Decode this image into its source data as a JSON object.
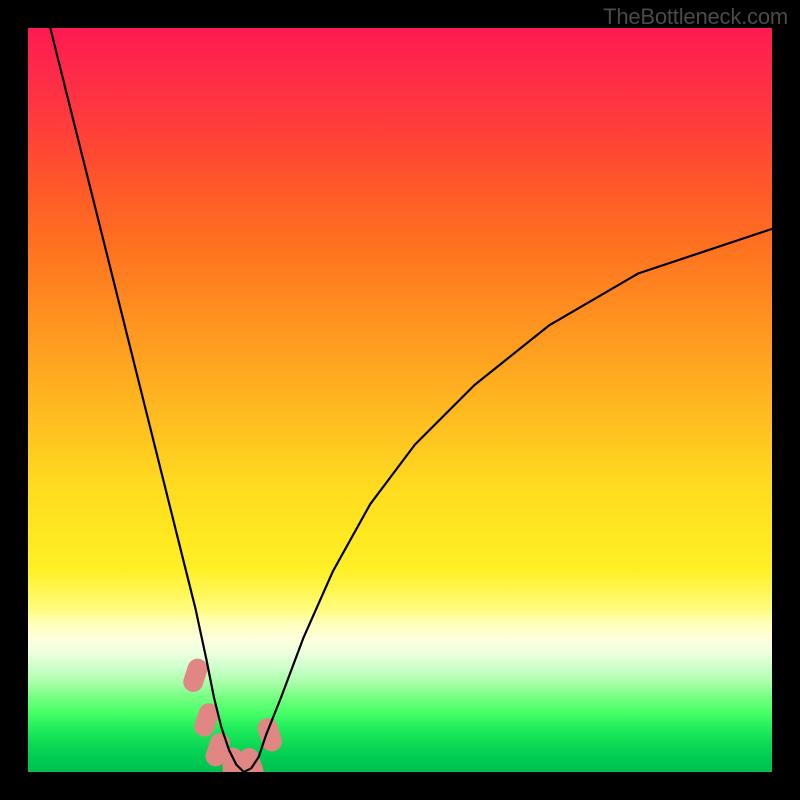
{
  "watermark": "TheBottleneck.com",
  "chart_data": {
    "type": "line",
    "title": "",
    "xlabel": "",
    "ylabel": "",
    "xlim": [
      0,
      100
    ],
    "ylim": [
      0,
      100
    ],
    "series": [
      {
        "name": "bottleneck-curve",
        "x": [
          3,
          6,
          9,
          12,
          15,
          18,
          21,
          22.5,
          24,
          25,
          26,
          27,
          28,
          29,
          30,
          31,
          32,
          34,
          37,
          41,
          46,
          52,
          60,
          70,
          82,
          100
        ],
        "y": [
          100,
          88,
          76,
          64,
          52,
          40,
          28,
          22,
          15,
          10,
          6,
          3,
          1,
          0,
          0.5,
          2,
          5,
          10,
          18,
          27,
          36,
          44,
          52,
          60,
          67,
          73
        ]
      }
    ],
    "highlight_zone": {
      "note": "pink rounded blobs near curve minimum",
      "points": [
        {
          "x": 22.5,
          "y": 13
        },
        {
          "x": 24.0,
          "y": 7
        },
        {
          "x": 25.5,
          "y": 3
        },
        {
          "x": 27.5,
          "y": 1
        },
        {
          "x": 30.0,
          "y": 1
        },
        {
          "x": 32.5,
          "y": 5
        }
      ]
    },
    "colors": {
      "curve": "#000000",
      "blob": "#e08784",
      "gradient_top": "#ff1a52",
      "gradient_mid": "#ffd020",
      "gradient_bottom": "#00c050"
    }
  }
}
